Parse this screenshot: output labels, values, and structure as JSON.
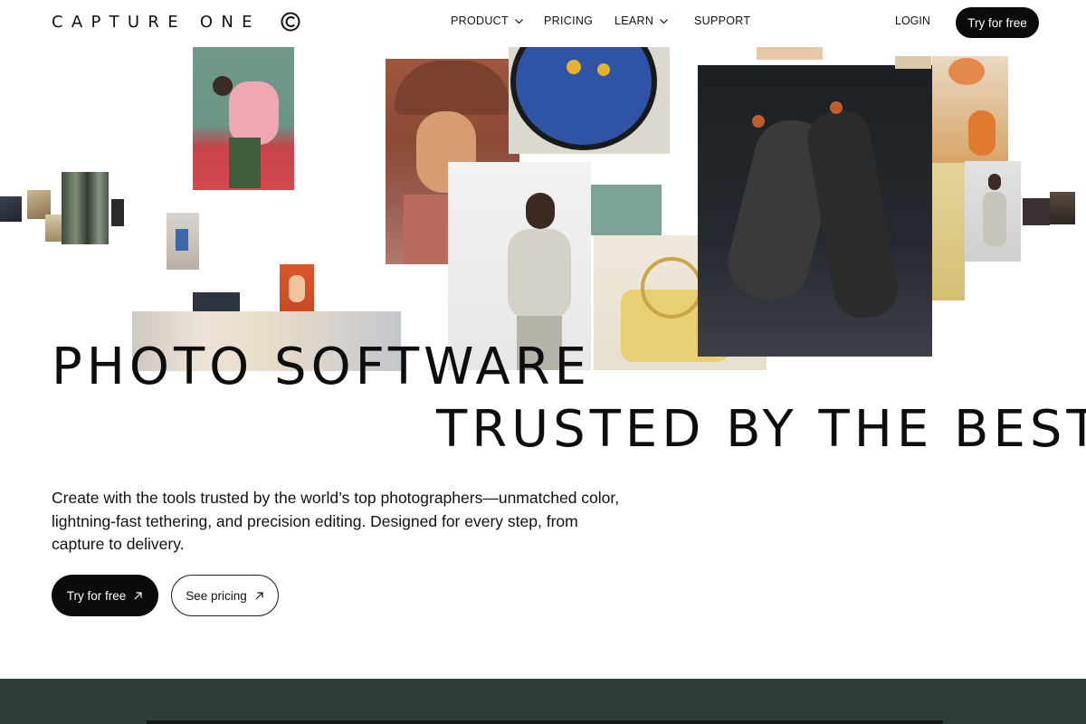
{
  "brand": {
    "name": "CAPTURE ONE",
    "logo_icon": "capture-one-mark-icon"
  },
  "nav": {
    "items": [
      {
        "label": "PRODUCT",
        "has_dropdown": true
      },
      {
        "label": "PRICING",
        "has_dropdown": false
      },
      {
        "label": "LEARN",
        "has_dropdown": true
      },
      {
        "label": "SUPPORT",
        "has_dropdown": false
      }
    ],
    "login_label": "LOGIN",
    "cta_label": "Try for free"
  },
  "hero": {
    "headline_line1": "PHOTO SOFTWARE",
    "headline_line2": "TRUSTED BY THE BEST",
    "lede": "Create with the tools trusted by the world’s top photographers—unmatched color, lightning-fast tethering, and precision editing. Designed for every step, from capture to delivery.",
    "primary_cta": "Try for free",
    "secondary_cta": "See pricing",
    "cta_icon": "arrow-up-right-icon"
  },
  "colors": {
    "text": "#111111",
    "button_dark": "#0b0b0b",
    "band": "#2f3f37"
  }
}
